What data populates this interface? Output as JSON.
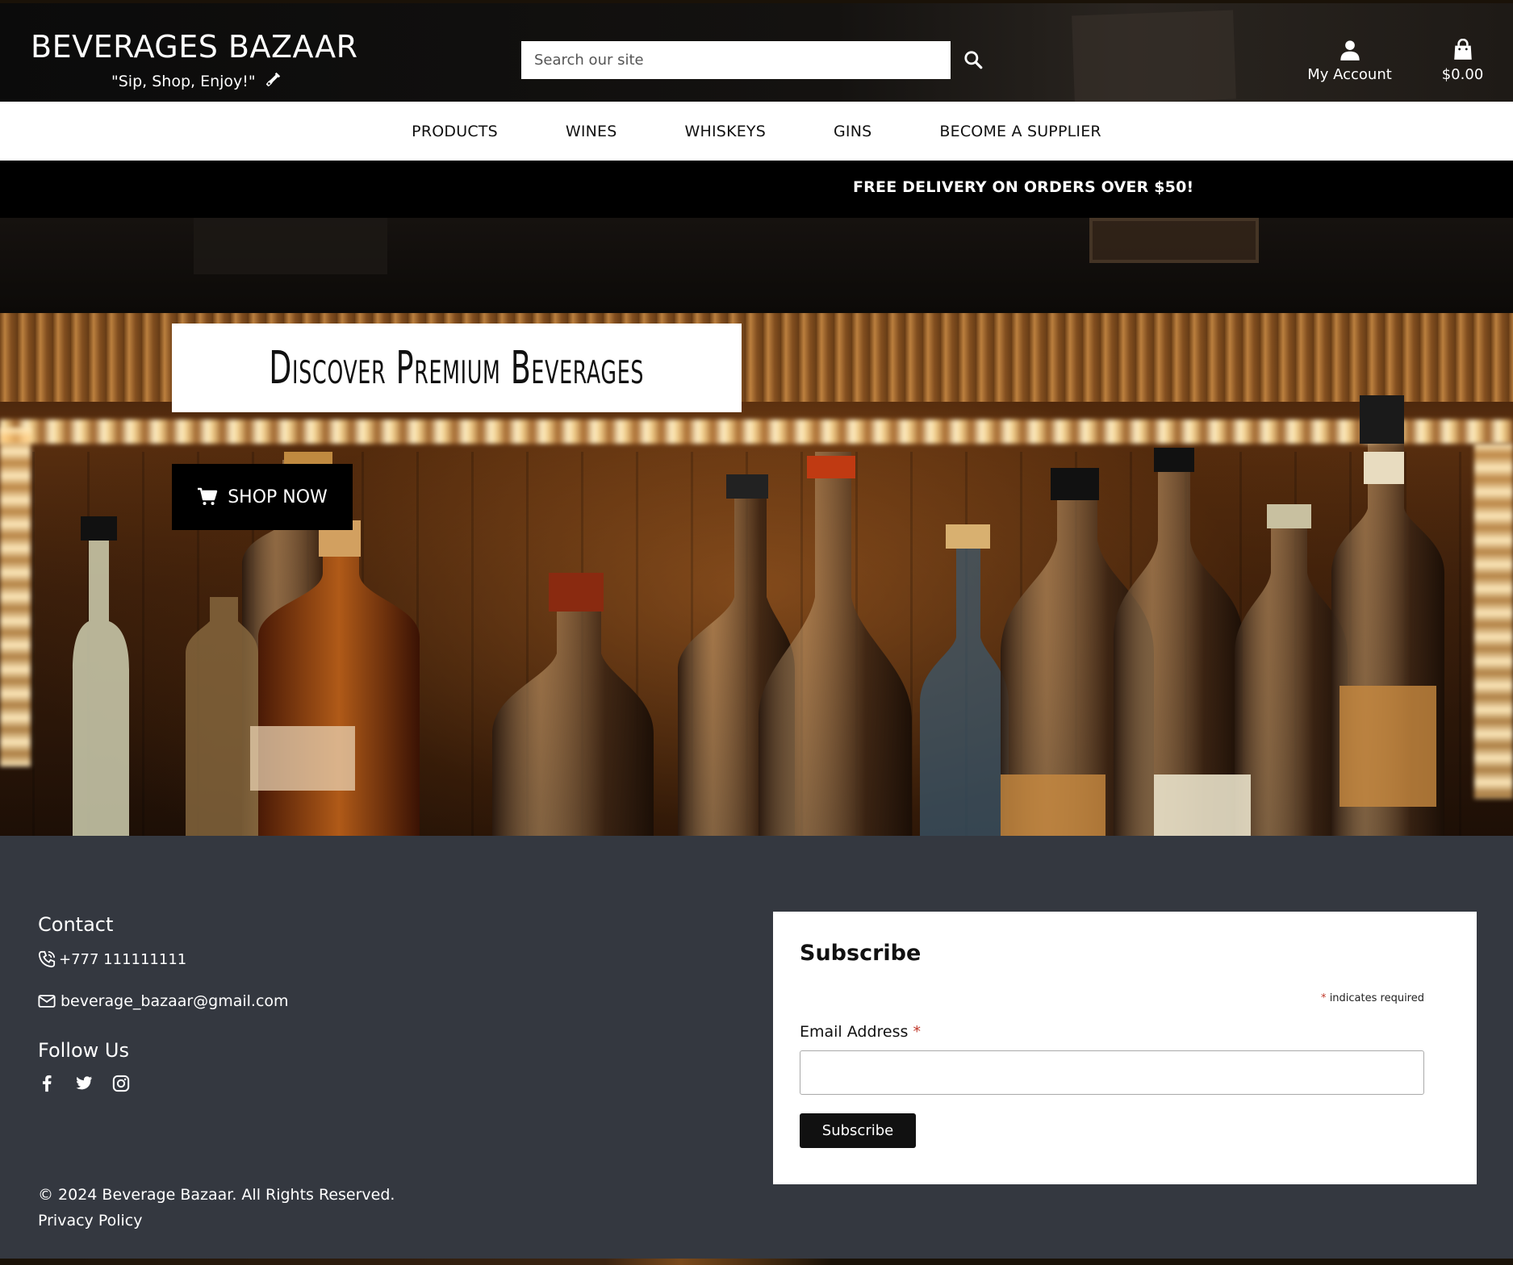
{
  "header": {
    "brand_title": "BEVERAGES BAZAAR",
    "tagline": "\"Sip, Shop, Enjoy!\"",
    "search_placeholder": "Search our site",
    "account_label": "My Account",
    "cart_total": "$0.00"
  },
  "nav": {
    "items": [
      "PRODUCTS",
      "WINES",
      "WHISKEYS",
      "GINS",
      "BECOME A SUPPLIER"
    ]
  },
  "promo": {
    "text": "FREE DELIVERY ON ORDERS OVER $50!"
  },
  "hero": {
    "heading": "Discover Premium Beverages",
    "cta_label": "SHOP NOW"
  },
  "footer": {
    "contact_heading": "Contact",
    "phone": "+777 111111111",
    "email": "beverage_bazaar@gmail.com",
    "follow_heading": "Follow Us",
    "socials": [
      "facebook-icon",
      "twitter-icon",
      "instagram-icon"
    ],
    "copyright": "© 2024 Beverage Bazaar. All Rights Reserved.",
    "privacy_label": "Privacy Policy"
  },
  "subscribe": {
    "title": "Subscribe",
    "required_star": "*",
    "required_note": "indicates required",
    "email_label": "Email Address",
    "button_label": "Subscribe"
  },
  "colors": {
    "header_bg": "#0b0b0b",
    "nav_bg": "#ffffff",
    "promo_bg": "#000000",
    "footer_bg": "#343840",
    "required_star": "#c0392b"
  }
}
